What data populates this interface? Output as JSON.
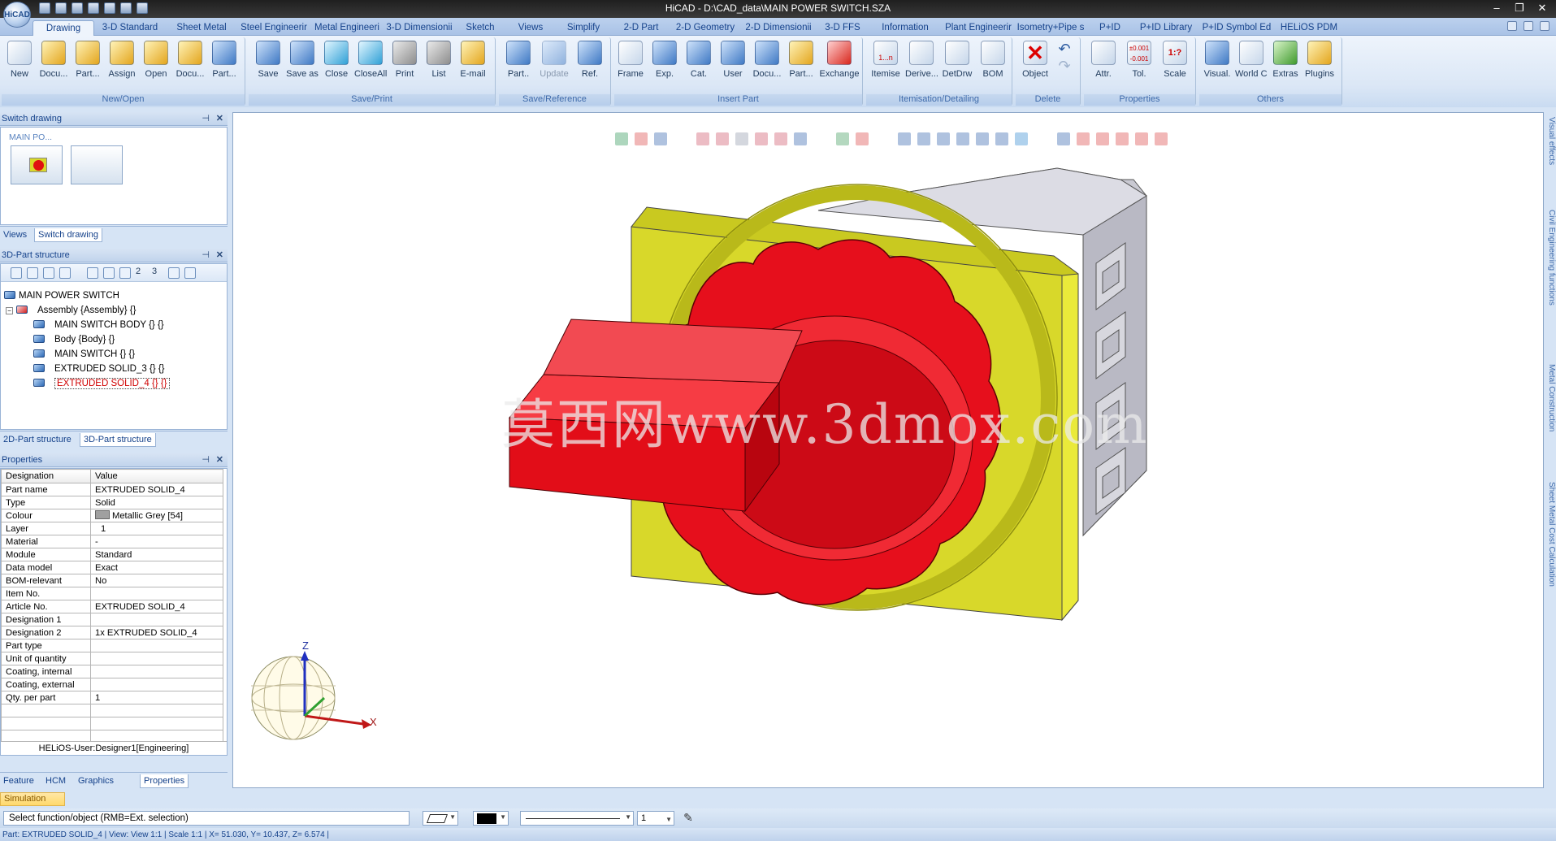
{
  "window": {
    "title": "HiCAD - D:\\CAD_data\\MAIN POWER SWITCH.SZA",
    "app_button": "HiCAD"
  },
  "ribbon_tabs": [
    "Drawing",
    "3-D Standard",
    "Sheet Metal",
    "Steel Engineerir",
    "Metal Engineeri",
    "3-D Dimensionii",
    "Sketch",
    "Views",
    "Simplify",
    "2-D Part",
    "2-D Geometry",
    "2-D Dimensionii",
    "3-D FFS",
    "Information",
    "Plant Engineerir",
    "Isometry+Pipe s",
    "P+ID",
    "P+ID Library",
    "P+ID Symbol Ed",
    "HELiOS PDM"
  ],
  "ribbon_groups": {
    "new_open": {
      "label": "New/Open",
      "buttons": [
        "New",
        "Docu...",
        "Part...",
        "Assign",
        "Open",
        "Docu...",
        "Part..."
      ]
    },
    "save_print": {
      "label": "Save/Print",
      "buttons": [
        "Save",
        "Save as",
        "Close",
        "CloseAll",
        "Print",
        "List",
        "E-mail"
      ]
    },
    "save_reference": {
      "label": "Save/Reference",
      "buttons": [
        "Part..",
        "Update",
        "Ref."
      ]
    },
    "insert_part": {
      "label": "Insert Part",
      "buttons": [
        "Frame",
        "Exp.",
        "Cat.",
        "User",
        "Docu...",
        "Part...",
        "Exchange"
      ]
    },
    "itemisation": {
      "label": "Itemisation/Detailing",
      "buttons": [
        "Itemise",
        "Derive...",
        "DetDrw",
        "BOM"
      ]
    },
    "delete": {
      "label": "Delete",
      "buttons": [
        "Object"
      ]
    },
    "properties": {
      "label": "Properties",
      "buttons": [
        "Attr.",
        "Tol.",
        "Scale"
      ]
    },
    "others": {
      "label": "Others",
      "buttons": [
        "Visual.",
        "World CS",
        "Extras",
        "Plugins"
      ]
    }
  },
  "tol_icon_text": [
    "±0.001",
    "-0.001"
  ],
  "scale_icon_text": "1:?",
  "itemise_icon_text": "1...n",
  "switch_drawing": {
    "header": "Switch drawing",
    "thumb_label": "MAIN PO...",
    "tabs": [
      "Views",
      "Switch drawing"
    ]
  },
  "part_structure": {
    "header": "3D-Part structure",
    "toolbar_numbers": [
      "2",
      "3"
    ],
    "tree": [
      {
        "label": "MAIN POWER SWITCH",
        "level": 0
      },
      {
        "label": "Assembly {Assembly} {}",
        "level": 1
      },
      {
        "label": "MAIN SWITCH BODY {} {}",
        "level": 2
      },
      {
        "label": "Body {Body} {}",
        "level": 2
      },
      {
        "label": "MAIN SWITCH {} {}",
        "level": 2
      },
      {
        "label": "EXTRUDED SOLID_3 {} {}",
        "level": 2
      },
      {
        "label": "EXTRUDED SOLID_4 {} {}",
        "level": 2,
        "selected": true
      }
    ],
    "tabs": [
      "2D-Part structure",
      "3D-Part structure"
    ]
  },
  "properties": {
    "header": "Properties",
    "columns": [
      "Designation",
      "Value"
    ],
    "rows": [
      [
        "Part name",
        "EXTRUDED SOLID_4"
      ],
      [
        "Type",
        "Solid"
      ],
      [
        "Colour",
        "Metallic Grey [54]"
      ],
      [
        "Layer",
        "1"
      ],
      [
        "Material",
        "-"
      ],
      [
        "Module",
        "Standard"
      ],
      [
        "Data model",
        "Exact"
      ],
      [
        "BOM-relevant",
        "No"
      ],
      [
        "Item No.",
        ""
      ],
      [
        "Article No.",
        "EXTRUDED SOLID_4"
      ],
      [
        "Designation 1",
        ""
      ],
      [
        "Designation 2",
        "1x EXTRUDED SOLID_4"
      ],
      [
        "Part type",
        ""
      ],
      [
        "Unit of quantity",
        ""
      ],
      [
        "Coating, internal",
        ""
      ],
      [
        "Coating, external",
        ""
      ],
      [
        "Qty. per part",
        "1"
      ]
    ],
    "user": "HELiOS-User:Designer1[Engineering]",
    "tabs": [
      "Feature",
      "HCM",
      "Graphics",
      "Properties"
    ]
  },
  "viewport": {
    "watermark": "莫西网www.3dmox.com",
    "axis_labels": {
      "z": "Z",
      "x": "X"
    },
    "right_tabs": [
      "Visual effects",
      "Civil Engineering functions",
      "Metal Construction",
      "Sheet Metal Cost Calculation"
    ]
  },
  "bottom": {
    "simulation_tab": "Simulation",
    "command_prompt": "Select function/object (RMB=Ext. selection)",
    "line_width": "1",
    "status": "Part: EXTRUDED SOLID_4 | View: View 1:1 | Scale 1:1 | X= 51.030, Y= 10.437, Z= 6.574 |"
  },
  "colors": {
    "knob_red": "#e8101c",
    "plate_yellow": "#dcdc2a",
    "housing_grey": "#c8c8d0"
  }
}
